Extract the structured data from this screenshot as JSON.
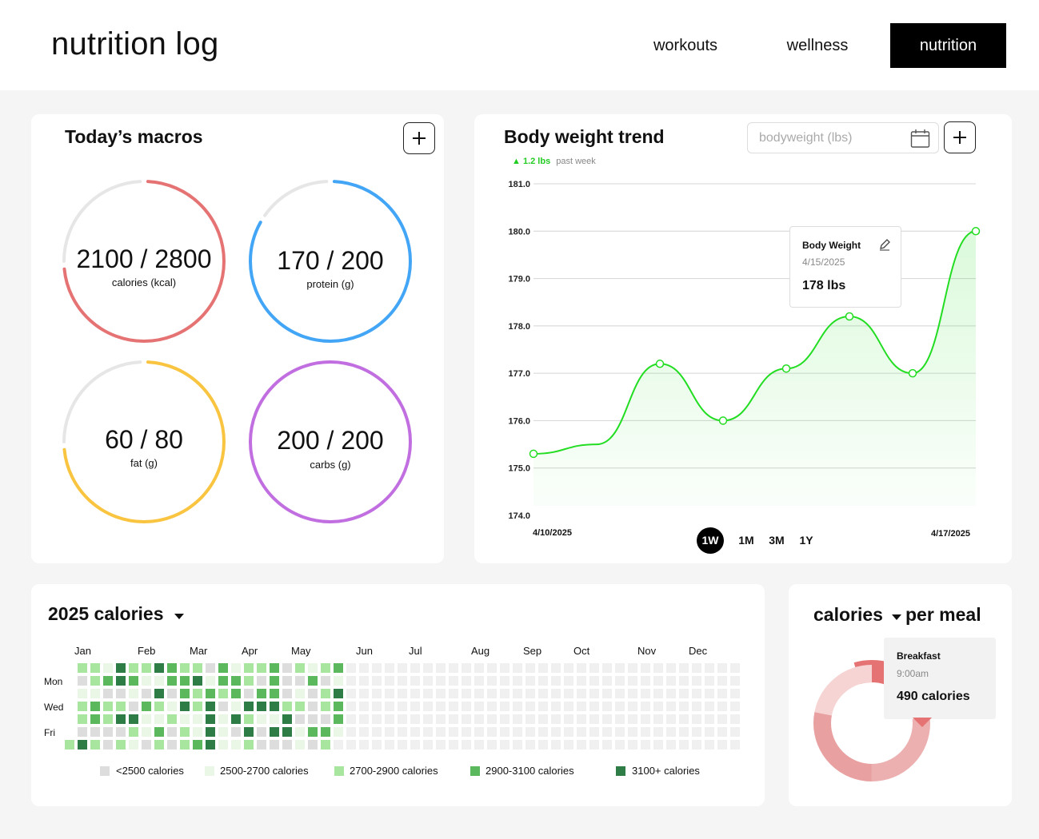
{
  "header": {
    "title": "nutrition log",
    "nav": [
      {
        "label": "workouts",
        "active": false
      },
      {
        "label": "wellness",
        "active": false
      },
      {
        "label": "nutrition",
        "active": true
      }
    ]
  },
  "macros": {
    "title": "Today’s macros",
    "add_icon": "plus-icon",
    "items": [
      {
        "value": "2100 / 2800",
        "label": "calories (kcal)",
        "fraction": 0.75,
        "color": "#e57373"
      },
      {
        "value": "170 / 200",
        "label": "protein (g)",
        "fraction": 0.85,
        "color": "#42a5f5"
      },
      {
        "value": "60 / 80",
        "label": "fat (g)",
        "fraction": 0.75,
        "color": "#f9c440"
      },
      {
        "value": "200 / 200",
        "label": "carbs (g)",
        "fraction": 1.0,
        "color": "#c06ee0"
      }
    ]
  },
  "bodyweight": {
    "title": "Body weight trend",
    "input_placeholder": "bodyweight (lbs)",
    "calendar_icon": "calendar-icon",
    "delta": "1.2 lbs",
    "delta_label": "past week",
    "ranges": [
      "1W",
      "1M",
      "3M",
      "1Y"
    ],
    "active_range": "1W",
    "x_start": "4/10/2025",
    "x_end": "4/17/2025",
    "tooltip": {
      "title": "Body Weight",
      "date": "4/15/2025",
      "value": "178 lbs"
    },
    "accent": "#22dd22"
  },
  "chart_data": {
    "type": "line",
    "x": [
      "4/10/2025",
      "4/11/2025",
      "4/12/2025",
      "4/13/2025",
      "4/14/2025",
      "4/15/2025",
      "4/16/2025",
      "4/17/2025"
    ],
    "y": [
      175.3,
      175.5,
      177.2,
      176.0,
      177.1,
      178.2,
      177.0,
      180.0
    ],
    "yticks": [
      "174.0",
      "175.0",
      "176.0",
      "177.0",
      "178.0",
      "179.0",
      "180.0",
      "181.0"
    ],
    "ylim": [
      174,
      181
    ],
    "grid": true
  },
  "calendar": {
    "title": "2025 calories",
    "months": [
      "Jan",
      "Feb",
      "Mar",
      "Apr",
      "May",
      "Jun",
      "Jul",
      "Aug",
      "Sep",
      "Oct",
      "Nov",
      "Dec"
    ],
    "days": [
      "Mon",
      "Wed",
      "Fri"
    ],
    "colors": [
      "#dddddd",
      "#eaf7e6",
      "#a8e6a0",
      "#5cb85c",
      "#2e7d46",
      "#f0f0f0"
    ],
    "legend": [
      {
        "label": "<2500 calories",
        "color": "#dddddd"
      },
      {
        "label": "2500-2700 calories",
        "color": "#eaf7e6"
      },
      {
        "label": "2700-2900 calories",
        "color": "#a8e6a0"
      },
      {
        "label": "2900-3100 calories",
        "color": "#5cb85c"
      },
      {
        "label": "3100+ calories",
        "color": "#2e7d46"
      }
    ]
  },
  "meals": {
    "metric": "calories",
    "suffix": "per meal",
    "tooltip": {
      "meal": "Breakfast",
      "time": "9:00am",
      "value": "490 calories"
    },
    "segments": [
      0.22,
      0.28,
      0.28,
      0.22
    ],
    "colors": [
      "#e57373",
      "#ecb0b0",
      "#e8a0a0",
      "#f6d4d4"
    ]
  }
}
